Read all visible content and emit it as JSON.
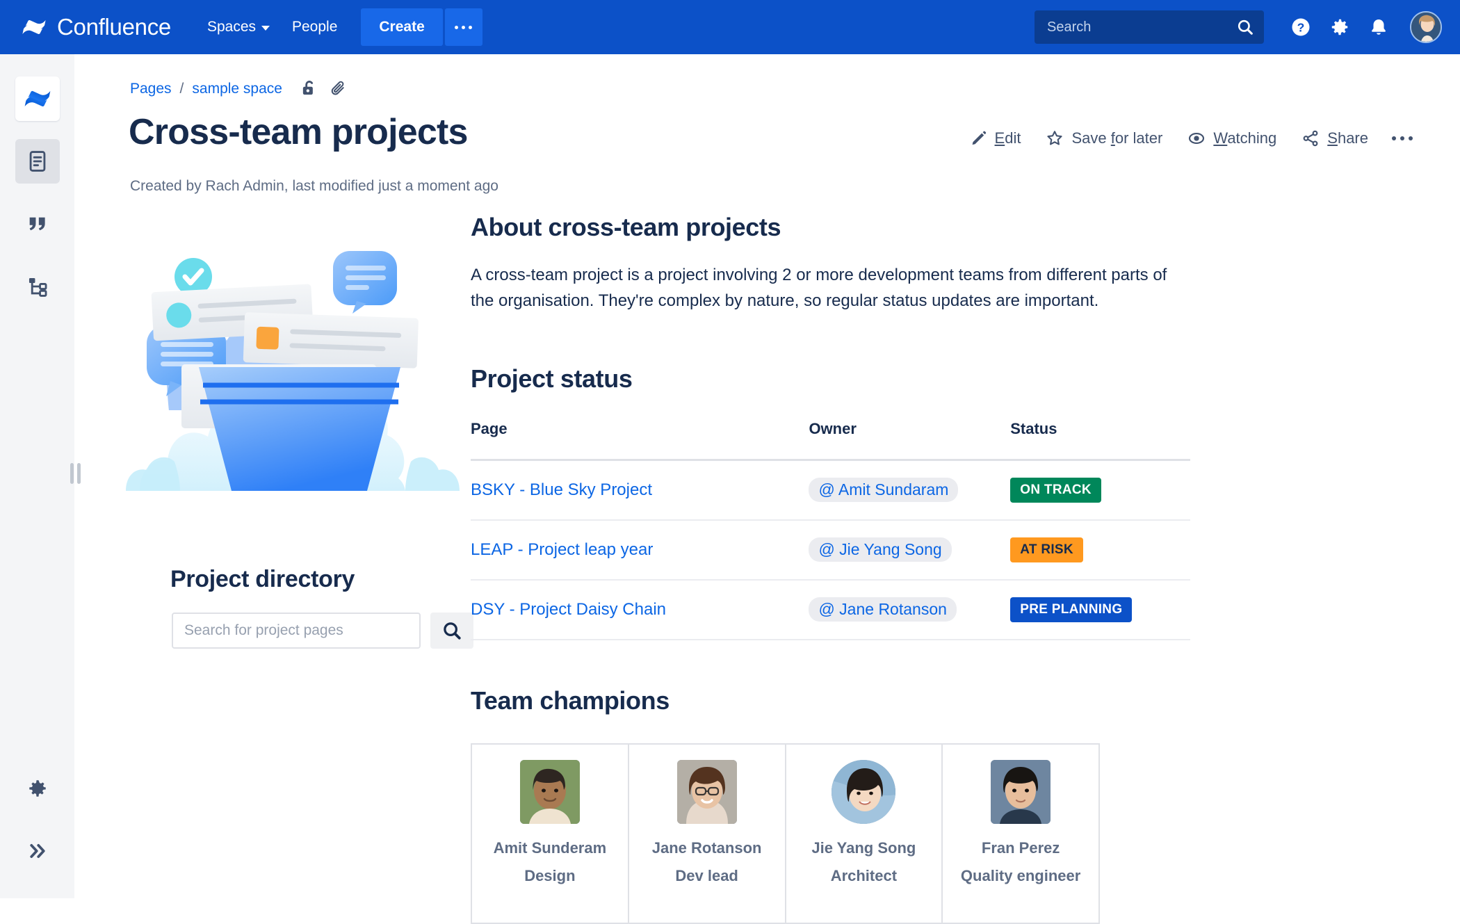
{
  "topnav": {
    "brand": "Confluence",
    "spaces_label": "Spaces",
    "people_label": "People",
    "create_label": "Create",
    "more_label": "•••",
    "search_placeholder": "Search",
    "search_value": "",
    "help_icon": "help-circle-icon",
    "settings_icon": "gear-icon",
    "notifications_icon": "bell-icon",
    "avatar_icon": "user-avatar",
    "bg_color": "#0C51C8",
    "create_color": "#1868E8"
  },
  "rail": {
    "logo_icon": "confluence-logo-icon",
    "items": [
      {
        "icon": "pages-document-icon",
        "active": true
      },
      {
        "icon": "blog-quote-icon",
        "active": false
      },
      {
        "icon": "page-tree-icon",
        "active": false
      }
    ],
    "bottom_items": [
      {
        "icon": "gear-icon"
      },
      {
        "icon": "expand-chevrons-icon"
      }
    ]
  },
  "breadcrumb": {
    "pages_label": "Pages",
    "separator": "/",
    "space_label": "sample space",
    "restrictions_icon": "unlocked-padlock-icon",
    "attachments_icon": "paperclip-icon"
  },
  "page": {
    "title": "Cross-team projects",
    "meta": "Created by Rach Admin, last modified just a moment ago"
  },
  "page_actions": [
    {
      "label": "Edit",
      "access_key": "E",
      "icon": "pencil-icon"
    },
    {
      "label": "Save for later",
      "access_key": "f",
      "icon": "star-icon"
    },
    {
      "label": "Watching",
      "access_key": "W",
      "icon": "eye-icon"
    },
    {
      "label": "Share",
      "access_key": "S",
      "icon": "share-icon"
    }
  ],
  "left_column": {
    "illustration_name": "cross-team-projects-illustration",
    "directory_title": "Project directory",
    "search_placeholder": "Search for project pages",
    "search_value": "",
    "search_button_icon": "search-icon"
  },
  "about": {
    "heading": "About cross-team projects",
    "paragraph": "A cross-team project is a project involving 2 or more development teams from different parts of the organisation. They're complex by nature, so regular status updates are important."
  },
  "project_status": {
    "heading": "Project status",
    "columns": [
      "Page",
      "Owner",
      "Status"
    ],
    "rows": [
      {
        "page": "BSKY - Blue Sky Project",
        "owner": "@ Amit Sundaram",
        "status": "ON TRACK",
        "status_bg": "#00875A",
        "status_fg": "#FFFFFF"
      },
      {
        "page": "LEAP - Project leap year",
        "owner": "@ Jie Yang Song",
        "status": "AT RISK",
        "status_bg": "#FF991F",
        "status_fg": "#172B4D"
      },
      {
        "page": "DSY - Project Daisy Chain",
        "owner": "@ Jane Rotanson",
        "status": "PRE PLANNING",
        "status_bg": "#0C51C8",
        "status_fg": "#FFFFFF"
      }
    ]
  },
  "team_champions": {
    "heading": "Team champions",
    "members": [
      {
        "name": "Amit Sunderam",
        "role": "Design",
        "photo": "photo-amit"
      },
      {
        "name": "Jane Rotanson",
        "role": "Dev lead",
        "photo": "photo-jane"
      },
      {
        "name": "Jie Yang Song",
        "role": "Architect",
        "photo": "photo-jie"
      },
      {
        "name": "Fran Perez",
        "role": "Quality engineer",
        "photo": "photo-fran"
      }
    ]
  }
}
